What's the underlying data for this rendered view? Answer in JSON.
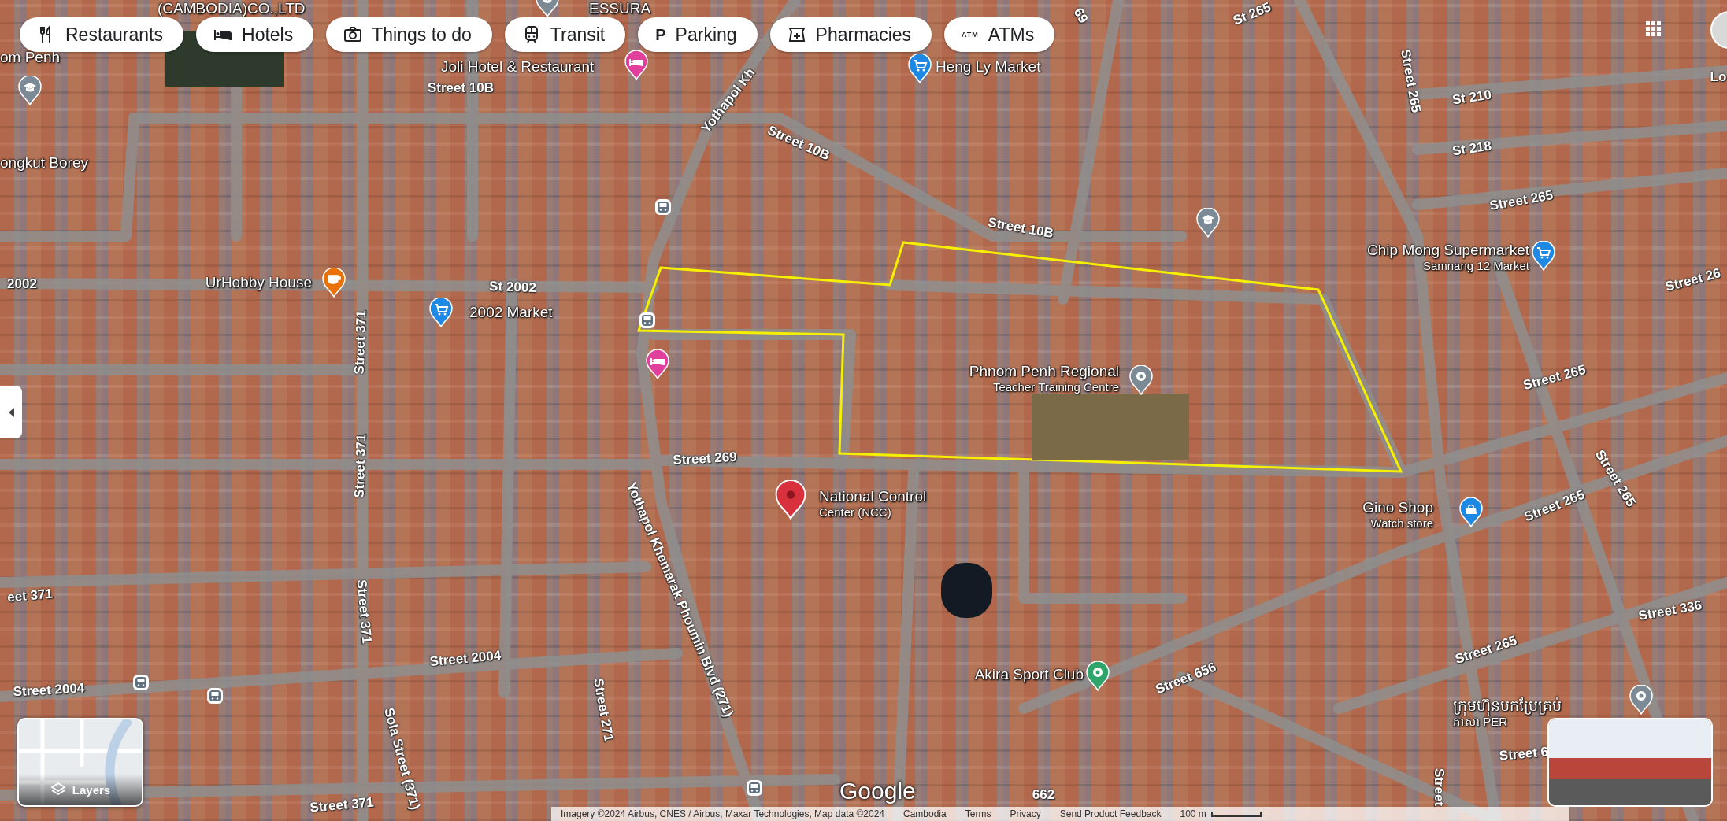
{
  "category_chips": [
    {
      "label": "Restaurants",
      "kind": "restaurants"
    },
    {
      "label": "Hotels",
      "kind": "hotels"
    },
    {
      "label": "Things to do",
      "kind": "things"
    },
    {
      "label": "Transit",
      "kind": "transit"
    },
    {
      "label": "Parking",
      "kind": "parking",
      "icon_text": "P"
    },
    {
      "label": "Pharmacies",
      "kind": "pharmacies"
    },
    {
      "label": "ATMs",
      "kind": "atms",
      "icon_text": "ATM"
    }
  ],
  "map": {
    "places": [
      {
        "lines": [
          "(CAMBODIA)CO.,LTD"
        ]
      },
      {
        "lines": [
          "ESSURA"
        ],
        "kind": "landmark"
      },
      {
        "lines": [
          "om Penh"
        ]
      },
      {
        "kind": "school"
      },
      {
        "lines": [
          "Joli Hotel & Restaurant"
        ],
        "kind": "hotel"
      },
      {
        "lines": [
          "Heng Ly Market"
        ],
        "kind": "shopping"
      },
      {
        "lines": [
          "ongkut Borey"
        ]
      },
      {
        "kind": "school"
      },
      {
        "lines": [
          "Chip Mong Supermarket",
          "Samnang 12 Market"
        ],
        "kind": "shopping"
      },
      {
        "lines": [
          "UrHobby House"
        ],
        "kind": "cafe"
      },
      {
        "lines": [
          "2002 Market"
        ],
        "kind": "shopping"
      },
      {
        "kind": "hotel"
      },
      {
        "lines": [
          "Phnom Penh Regional",
          "Teacher Training Centre"
        ],
        "kind": "landmark"
      },
      {
        "lines": [
          "National Control",
          "Center (NCC)"
        ],
        "kind": "selected"
      },
      {
        "lines": [
          "Gino Shop",
          "Watch store"
        ],
        "kind": "bag"
      },
      {
        "lines": [
          "Akira Sport Club"
        ],
        "kind": "sport"
      },
      {
        "lines": [
          "ក្រុមហ៊ុនបកប្រែគ្រប់",
          "ភាសា PER"
        ],
        "kind": "landmark"
      },
      {
        "kind": "bus"
      },
      {
        "kind": "bus"
      },
      {
        "kind": "bus"
      },
      {
        "kind": "bus"
      },
      {
        "kind": "bus"
      }
    ],
    "street_labels": [
      {
        "text": "Street 10B"
      },
      {
        "text": "Yothapol Kh"
      },
      {
        "text": "Street 10B"
      },
      {
        "text": "69"
      },
      {
        "text": "St 265"
      },
      {
        "text": "Street 265"
      },
      {
        "text": "St 210"
      },
      {
        "text": "St 218"
      },
      {
        "text": "Street 265"
      },
      {
        "text": "Street 10B"
      },
      {
        "text": "Lo"
      },
      {
        "text": "Street 26"
      },
      {
        "text": "2002"
      },
      {
        "text": "St 2002"
      },
      {
        "text": "Street 371"
      },
      {
        "text": "Street 371"
      },
      {
        "text": "Street 371"
      },
      {
        "text": "Street 265"
      },
      {
        "text": "Street 269"
      },
      {
        "text": "Yothapol Khemarak Phoumin Blvd (271)"
      },
      {
        "text": "Street 2004"
      },
      {
        "text": "Street 2004"
      },
      {
        "text": "eet 371"
      },
      {
        "text": "Street 271"
      },
      {
        "text": "Sola Street (371)"
      },
      {
        "text": "Street 371"
      },
      {
        "text": "Street 265"
      },
      {
        "text": "Street 265"
      },
      {
        "text": "Street 336"
      },
      {
        "text": "Street 656"
      },
      {
        "text": "Street 265"
      },
      {
        "text": "Street 6"
      },
      {
        "text": "Street"
      },
      {
        "text": "662"
      }
    ],
    "logo": "Google",
    "layers_button": {
      "label": "Layers"
    },
    "attribution": [
      {
        "text": "Imagery ©2024 Airbus, CNES / Airbus, Maxar Technologies, Map data ©2024"
      },
      {
        "text": "Cambodia"
      },
      {
        "text": "Terms"
      },
      {
        "text": "Privacy"
      },
      {
        "text": "Send Product Feedback"
      }
    ],
    "scale": "100 m"
  }
}
